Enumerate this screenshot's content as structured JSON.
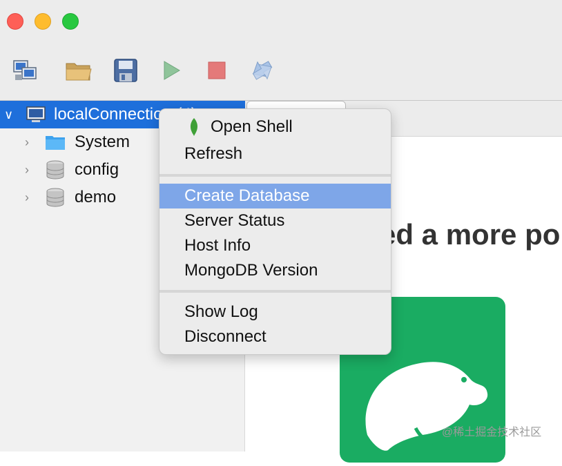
{
  "tree": {
    "items": [
      {
        "label": "localConnection (4)",
        "icon": "monitor-icon",
        "selected": true
      },
      {
        "label": "System",
        "icon": "folder-icon"
      },
      {
        "label": "config",
        "icon": "database-icon"
      },
      {
        "label": "demo",
        "icon": "database-icon"
      }
    ]
  },
  "toolbar": {
    "buttons": [
      "connect-icon",
      "open-folder-icon",
      "save-icon",
      "run-icon",
      "stop-icon",
      "refresh-icon"
    ]
  },
  "menu": {
    "open_shell": "Open Shell",
    "refresh": "Refresh",
    "create_database": "Create Database",
    "server_status": "Server Status",
    "host_info": "Host Info",
    "mongodb_version": "MongoDB Version",
    "show_log": "Show Log",
    "disconnect": "Disconnect"
  },
  "content": {
    "promo_text": "ed a more po"
  },
  "watermark": "@稀土掘金技术社区",
  "colors": {
    "selection": "#1e6fdb",
    "menu_highlight": "#7ea6e8",
    "promo_green": "#1aac62"
  }
}
